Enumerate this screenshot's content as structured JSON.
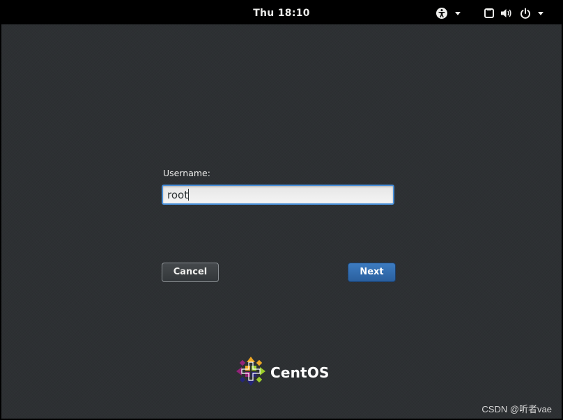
{
  "topbar": {
    "clock": "Thu 18:10",
    "icons": [
      "accessibility-icon",
      "chevron-down-icon",
      "screen-icon",
      "volume-icon",
      "power-icon",
      "chevron-down-icon"
    ]
  },
  "login": {
    "username_label": "Username:",
    "username_value": "root",
    "cancel_label": "Cancel",
    "next_label": "Next"
  },
  "branding": {
    "logo_text": "CentOS",
    "logo_icon": "centos-logo"
  },
  "watermark": "CSDN @听者vae",
  "colors": {
    "background": "#2d3033",
    "topbar": "#000000",
    "focus_border": "#4a90d9",
    "next_button": "#3470b2"
  }
}
